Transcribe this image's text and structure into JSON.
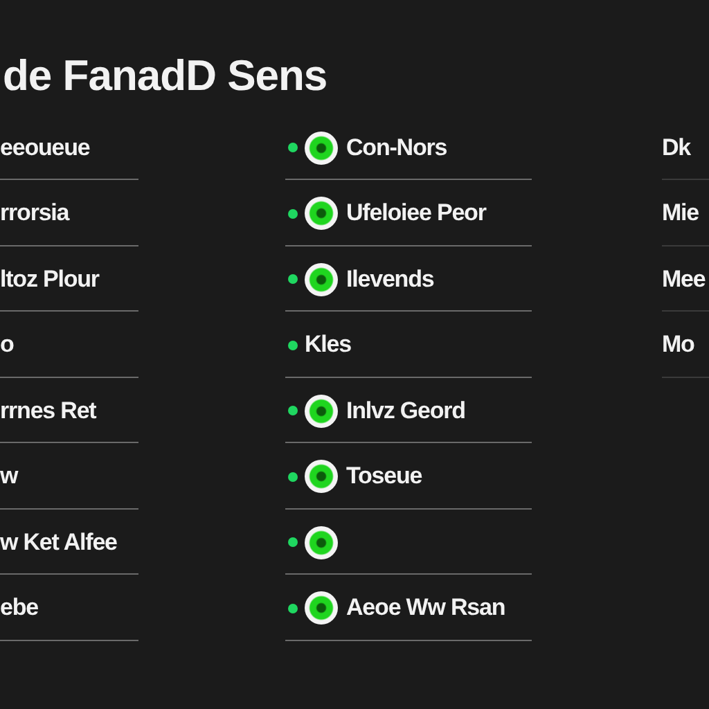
{
  "title": "de FanadD Sens",
  "column_1": [
    {
      "label": "eeoueue"
    },
    {
      "label": "rrorsia"
    },
    {
      "label": "ltoz Plour"
    },
    {
      "label": "o"
    },
    {
      "label": "rrnes Ret"
    },
    {
      "label": "w"
    },
    {
      "label": "w Ket Alfee"
    },
    {
      "label": "ebe"
    }
  ],
  "column_2": [
    {
      "kind": "radio",
      "selected": true,
      "label": "Con-Nors"
    },
    {
      "kind": "radio",
      "selected": true,
      "label": "Ufeloiee Peor"
    },
    {
      "kind": "radio",
      "selected": true,
      "label": "Ilevends"
    },
    {
      "kind": "plain",
      "label": "Kles"
    },
    {
      "kind": "radio",
      "selected": true,
      "label": "Inlvz Geord"
    },
    {
      "kind": "radio",
      "selected": true,
      "label": "Toseue"
    },
    {
      "kind": "radio",
      "selected": true
    },
    {
      "kind": "radio",
      "selected": true,
      "label": "Aeoe Ww Rsan"
    }
  ],
  "column_3": [
    {
      "label": "Dk"
    },
    {
      "label": "Mie"
    },
    {
      "label": "Mee"
    },
    {
      "label": "Mo"
    }
  ]
}
